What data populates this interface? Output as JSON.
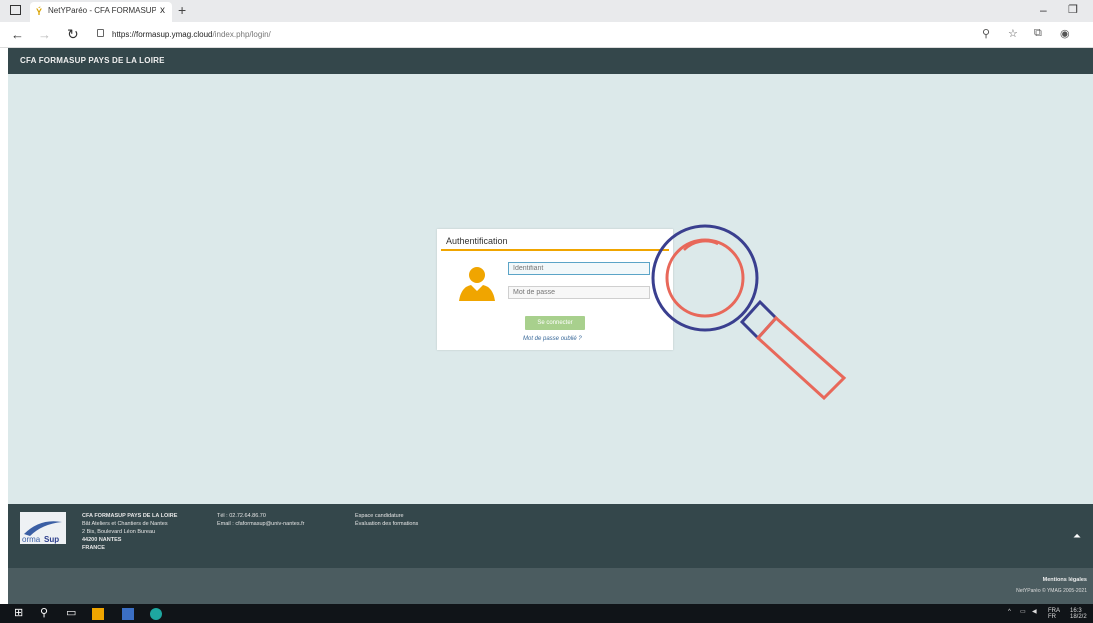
{
  "browser": {
    "tab_title": "NetYParéo - CFA FORMASUP PAYS DE LA LOIRE",
    "close_glyph": "x",
    "new_tab_glyph": "+",
    "url_host": "https://formasup.ymag.cloud",
    "url_path": "/index.php/login/"
  },
  "site": {
    "header_title": "CFA FORMASUP PAYS DE LA LOIRE"
  },
  "login": {
    "title": "Authentification",
    "username_placeholder": "Identifiant",
    "password_placeholder": "Mot de passe",
    "submit_label": "Se connecter",
    "forgot_label": "Mot de passe oublié ?"
  },
  "footer": {
    "org_name": "CFA FORMASUP PAYS DE LA LOIRE",
    "address1": "Bât Ateliers et Chantiers de Nantes",
    "address2": "2 Bis, Boulevard Léon Bureau",
    "address3": "44200 NANTES",
    "address4": "FRANCE",
    "phone": "Tél : 02.72.64.86.70",
    "email": "Email : cfaformasup@univ-nantes.fr",
    "link1": "Espace candidature",
    "link2": "Évaluation des formations",
    "legal": "Mentions légales",
    "copyright": "NetYParéo © YMAG 2005-2021"
  },
  "taskbar": {
    "lang": "FRA",
    "lang_sub": "FR",
    "time": "16:3",
    "date": "18/2/2"
  },
  "colors": {
    "header_bg": "#34474b",
    "page_bg": "#dce9ea",
    "accent_line": "#f0a500",
    "avatar": "#f0a500",
    "button": "#a8d08d",
    "magnifier_ring": "#3a3f8f",
    "magnifier_lens": "#e8685a"
  }
}
